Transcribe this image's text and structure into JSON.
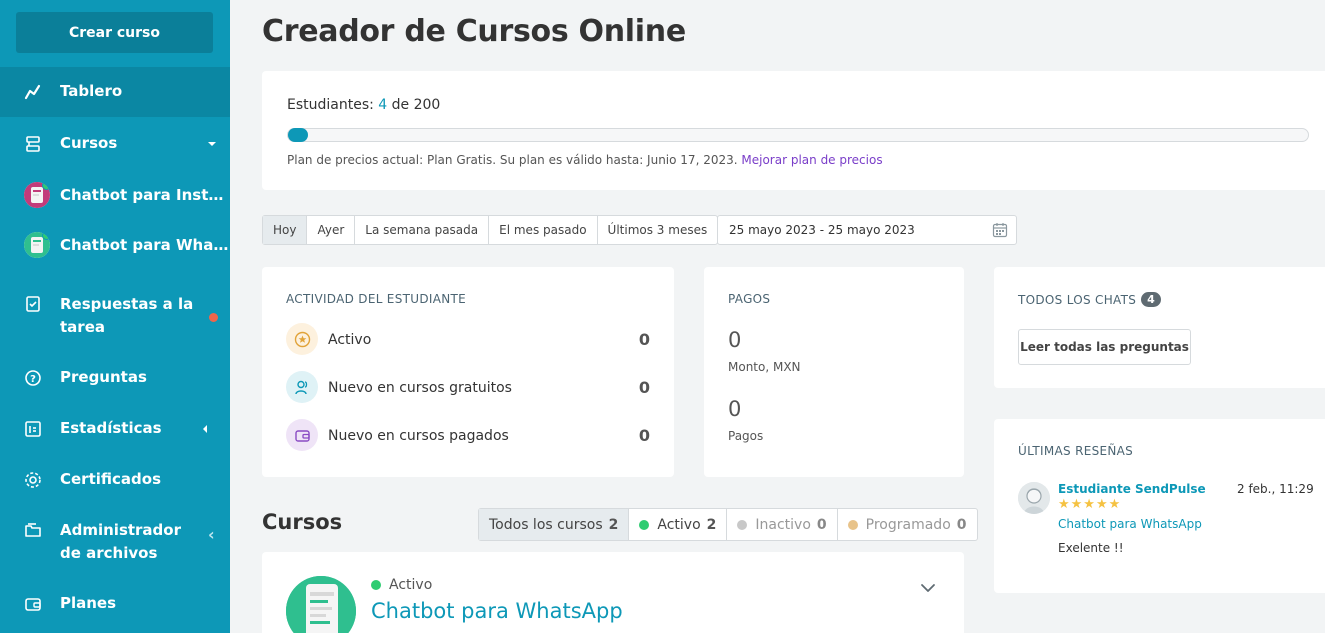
{
  "sidebar": {
    "create_label": "Crear curso",
    "items": [
      {
        "label": "Tablero",
        "icon": "chart-line-icon"
      },
      {
        "label": "Cursos",
        "icon": "courses-icon"
      },
      {
        "label": "Chatbot para Inst…",
        "icon": "avatar"
      },
      {
        "label": "Chatbot para Wha…",
        "icon": "avatar"
      },
      {
        "label": "Respuestas a la tarea",
        "icon": "homework-icon"
      },
      {
        "label": "Preguntas",
        "icon": "question-icon"
      },
      {
        "label": "Estadísticas",
        "icon": "stats-icon"
      },
      {
        "label": "Certificados",
        "icon": "certificate-icon"
      },
      {
        "label": "Administrador de archivos",
        "icon": "folder-icon"
      },
      {
        "label": "Planes",
        "icon": "wallet-icon"
      }
    ]
  },
  "header": {
    "title": "Creador de Cursos Online"
  },
  "plan": {
    "students_prefix": "Estudiantes: ",
    "students_count": "4",
    "students_suffix": " de 200",
    "progress_fraction": 0.02,
    "plan_text": "Plan de precios actual: Plan Gratis. Su plan es válido hasta: Junio 17, 2023.",
    "upgrade_link": "Mejorar plan de precios"
  },
  "filters": {
    "options": [
      "Hoy",
      "Ayer",
      "La semana pasada",
      "El mes pasado",
      "Últimos 3 meses"
    ],
    "active_index": 0,
    "date_range": "25 mayo 2023 - 25 mayo 2023"
  },
  "activity": {
    "title": "ACTIVIDAD DEL ESTUDIANTE",
    "rows": [
      {
        "label": "Activo",
        "value": "0"
      },
      {
        "label": "Nuevo en cursos gratuitos",
        "value": "0"
      },
      {
        "label": "Nuevo en cursos pagados",
        "value": "0"
      }
    ]
  },
  "payments": {
    "title": "PAGOS",
    "amount": "0",
    "amount_label": "Monto, MXN",
    "count": "0",
    "count_label": "Pagos"
  },
  "chats": {
    "title": "TODOS LOS CHATS",
    "count": "4",
    "button": "Leer todas las preguntas"
  },
  "reviews": {
    "title": "ÚLTIMAS RESEÑAS",
    "items": [
      {
        "name": "Estudiante SendPulse",
        "date": "2 feb., 11:29",
        "stars": "★★★★★",
        "course": "Chatbot para WhatsApp",
        "text": "Exelente !!"
      }
    ]
  },
  "courses": {
    "title": "Cursos",
    "filters": [
      {
        "label": "Todos los cursos",
        "count": "2"
      },
      {
        "label": "Activo",
        "count": "2",
        "color": "#2ecc71"
      },
      {
        "label": "Inactivo",
        "count": "0",
        "color": "#c8c8c8"
      },
      {
        "label": "Programado",
        "count": "0",
        "color": "#e8c38a"
      }
    ],
    "items": [
      {
        "status": "Activo",
        "name": "Chatbot para WhatsApp"
      }
    ]
  },
  "colors": {
    "accent": "#0d98b7",
    "sidebar": "#0d98b7",
    "link_purple": "#7a3ec9",
    "active_green": "#2ecc71"
  }
}
